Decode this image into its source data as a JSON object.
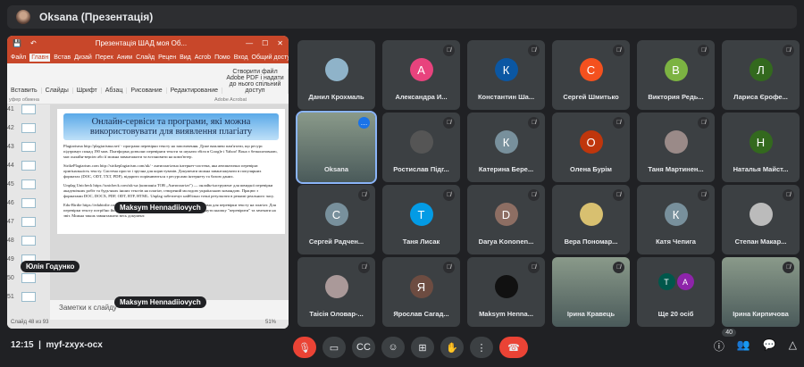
{
  "header": {
    "title": "Oksana (Презентація)"
  },
  "ppt": {
    "window_title": "Презентація ШАД моя Об...",
    "menu": [
      "Файл",
      "Главн",
      "Встав",
      "Дизай",
      "Перех",
      "Аним",
      "Слайд",
      "Рецен",
      "Вид",
      "Acrob",
      "Помо",
      "Вход",
      "Общий доступ"
    ],
    "ribbon": [
      "Вставить",
      "Слайды",
      "Шрифт",
      "Абзац",
      "Рисование",
      "Редактирование",
      "Створити файл Adobe PDF і надати до нього спільний доступ"
    ],
    "ribbon_groups": [
      "уфер обмена",
      "Adobe Acrobat"
    ],
    "thumb_numbers": [
      "41",
      "42",
      "43",
      "44",
      "45",
      "46",
      "47",
      "48",
      "49",
      "50",
      "51"
    ],
    "slide_title": "Онлайн-сервіси та програми, які можна використовувати для виявлення плагіату",
    "bullets": [
      "Plagiarisma http://plagiarisma.net/ - програма перевірки тексту на запозичення. Дуже важливо пам'ятати, що ресурс підтримує понад 190 мов. Платформа дозволяє перевіряти тексти та шукати збіги в Google і Yahoo! Вона є безкоштовною, має онлайн-версію або її можна завантажити та встановити на комп'ютер.",
      "StrikePlagiarism.com http://strikeplagiarism.com/uk/ - антиплагіатна інтернет-система, яка автоматично перевіряє оригінальність тексту. Система проста і зручна для користувачів. Документи можна завантажувати в популярних форматах (DOC, ODT, TXT, PDF), відкрито порівнюються з ресурсами інтернету та базою даних.",
      "Unplag Unicheck https://unicheck.com/uk-ua (компанія ТОВ „Антиплагіат\") — онлайн-інструмент для швидкої перевірки академічних робіт та будь-яких інших текстів на плагіат, створений молодою українською командою. Працює з форматами DOC, DOCX, PDF, ODT, RTF, HTML. Unplag забезпечує найбільш точні результати в режимі реального часу.",
      "Edu-Birdie https://edubirdie.com/perevirka-na-plagiat - безкоштовна онлайн-платформа для перевірки тексту на плагіат. Для перевірки тексту потрібно його скопіювати та вставити у відповідне вікно, натиснути кнопку \"перевірити\" та зачекати на звіт. Можна також завантажити весь документ."
    ],
    "notes": "Заметки к слайду",
    "status": "Слайд 48 из 93",
    "zoom": "51%"
  },
  "overlay_chips": [
    "Maksym Hennadiiovych",
    "Юлія Годунко",
    "Maksym Hennadiiovych"
  ],
  "tiles": [
    {
      "name": "Данил Крохмаль",
      "initial": "",
      "color": "#8fb3c9",
      "muted": false
    },
    {
      "name": "Александра И...",
      "initial": "А",
      "color": "#e8437d",
      "muted": true
    },
    {
      "name": "Константин Ша...",
      "initial": "К",
      "color": "#0b57a3",
      "muted": true
    },
    {
      "name": "Сергей Шмитько",
      "initial": "С",
      "color": "#f4511e",
      "muted": true
    },
    {
      "name": "Виктория Редь...",
      "initial": "В",
      "color": "#7cb342",
      "muted": true
    },
    {
      "name": "Лариса Єрофе...",
      "initial": "Л",
      "color": "#33691e",
      "muted": true
    },
    {
      "name": "Oksana",
      "initial": "",
      "color": "#6d6d6d",
      "muted": false,
      "video": true,
      "selected": true
    },
    {
      "name": "Ростислав Підг...",
      "initial": "",
      "color": "#555",
      "muted": true
    },
    {
      "name": "Катерина Бере...",
      "initial": "К",
      "color": "#78909c",
      "muted": true
    },
    {
      "name": "Олена Бурім",
      "initial": "О",
      "color": "#bf360c",
      "muted": true
    },
    {
      "name": "Таня Мартинен...",
      "initial": "",
      "color": "#9a8a88",
      "muted": true
    },
    {
      "name": "Наталья Майст...",
      "initial": "Н",
      "color": "#33691e",
      "muted": false
    },
    {
      "name": "Сергей Радчен...",
      "initial": "С",
      "color": "#78909c",
      "muted": true
    },
    {
      "name": "Таня Лисак",
      "initial": "Т",
      "color": "#039be5",
      "muted": true
    },
    {
      "name": "Darya Kononen...",
      "initial": "D",
      "color": "#8d6e63",
      "muted": true
    },
    {
      "name": "Вера Пономар...",
      "initial": "",
      "color": "#d8c070",
      "muted": true
    },
    {
      "name": "Катя Чепига",
      "initial": "К",
      "color": "#78909c",
      "muted": true
    },
    {
      "name": "Степан Макар...",
      "initial": "",
      "color": "#bbb",
      "muted": true
    },
    {
      "name": "Таісія Оловар-...",
      "initial": "",
      "color": "#a99",
      "muted": true
    },
    {
      "name": "Ярослав Сагад...",
      "initial": "Я",
      "color": "#6d4c41",
      "muted": true
    },
    {
      "name": "Maksym Henna...",
      "initial": "",
      "color": "#111",
      "muted": true
    },
    {
      "name": "Ірина Кравець",
      "initial": "",
      "color": "#bcd",
      "muted": true,
      "video": true
    },
    {
      "name": "Ще 20 осіб",
      "initial": "",
      "color": "",
      "muted": false,
      "others": [
        "Т",
        "А"
      ]
    },
    {
      "name": "Ірина Кирпичова",
      "initial": "",
      "color": "#bcd",
      "muted": true,
      "video": true
    }
  ],
  "footer": {
    "time": "12:15",
    "code": "myf-zxyx-ocx",
    "participants": "40"
  }
}
